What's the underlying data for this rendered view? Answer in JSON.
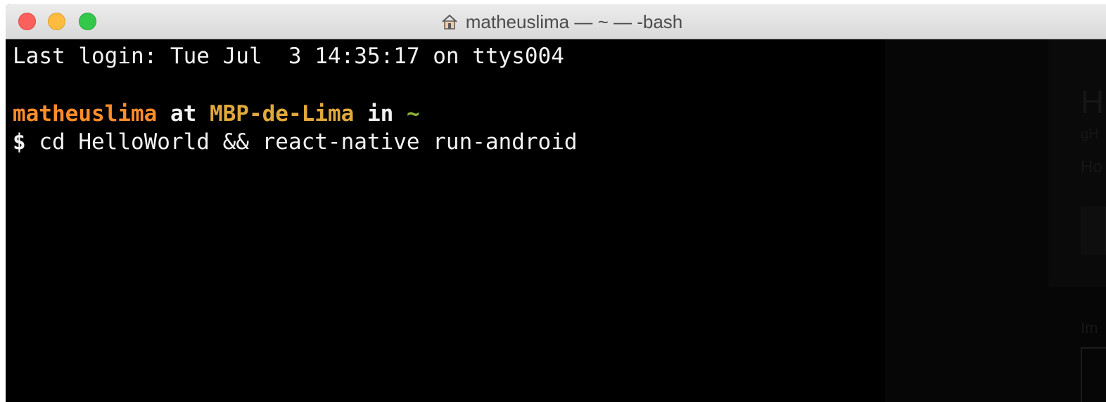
{
  "window": {
    "title": "matheuslima — ~ — -bash",
    "title_icon": "home-icon"
  },
  "terminal": {
    "last_login": "Last login: Tue Jul  3 14:35:17 on ttys004",
    "prompt": {
      "user": "matheuslima",
      "at": " at ",
      "host": "MBP-de-Lima",
      "in": " in ",
      "dir": "~"
    },
    "command_line": {
      "symbol": "$",
      "command": " cd HelloWorld && react-native run-android"
    }
  },
  "background_window": {
    "heading": "H",
    "line1": "gH",
    "line2": "Ho",
    "label": "Im"
  },
  "colors": {
    "user": "#ff8c2a",
    "host": "#e0a93b",
    "tilde": "#8db33b",
    "terminal_bg": "#000000",
    "terminal_fg": "#f2f2f2"
  }
}
